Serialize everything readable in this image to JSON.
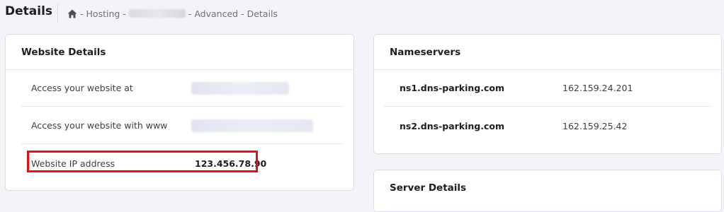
{
  "header": {
    "title": "Details",
    "breadcrumb": [
      "Hosting",
      "Advanced",
      "Details"
    ],
    "separator": "-"
  },
  "website_details": {
    "title": "Website Details",
    "rows": [
      {
        "label": "Access your website at",
        "value": ""
      },
      {
        "label": "Access your website with www",
        "value": ""
      },
      {
        "label": "Website IP address",
        "value": "123.456.78.90"
      }
    ]
  },
  "nameservers": {
    "title": "Nameservers",
    "rows": [
      {
        "name": "ns1.dns-parking.com",
        "ip": "162.159.24.201"
      },
      {
        "name": "ns2.dns-parking.com",
        "ip": "162.159.25.42"
      }
    ]
  },
  "server_details": {
    "title": "Server Details"
  },
  "colors": {
    "highlight": "#e0101a",
    "card_bg": "#ffffff",
    "page_bg": "#f3f3f8"
  },
  "icons": [
    "home-icon"
  ]
}
